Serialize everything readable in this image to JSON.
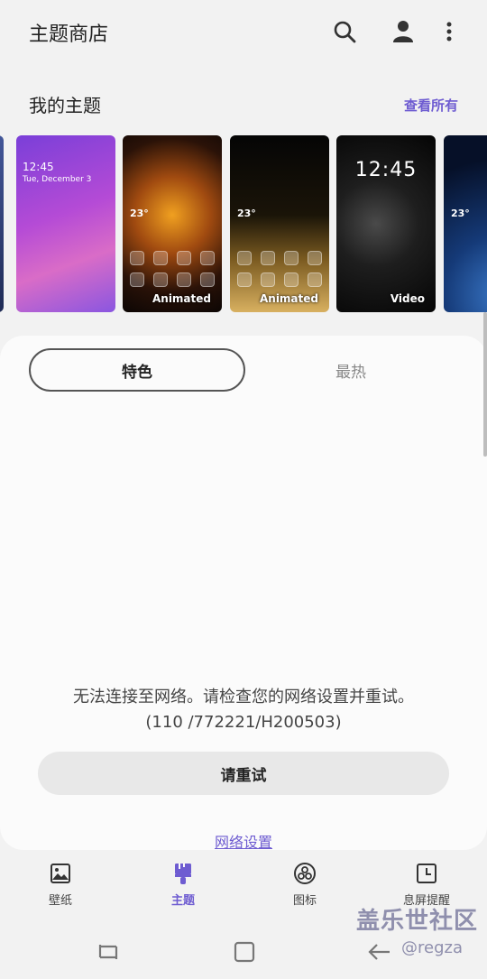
{
  "header": {
    "title": "主题商店",
    "icons": [
      "search-icon",
      "account-icon",
      "more-vert-icon"
    ]
  },
  "my_themes": {
    "title": "我的主题",
    "view_all": "查看所有",
    "thumbnails": [
      {
        "clock": "12:45",
        "date": "Tue, December 3",
        "badge": ""
      },
      {
        "weather": "23°",
        "badge": "Animated"
      },
      {
        "weather": "23°",
        "badge": "Animated"
      },
      {
        "clock": "12:45",
        "badge": "Video"
      },
      {
        "weather": "23°",
        "badge": ""
      }
    ]
  },
  "tabs": {
    "featured": "特色",
    "popular": "最热"
  },
  "error": {
    "message": "无法连接至网络。请检查您的网络设置并重试。",
    "code": "(110 /772221/H200503)",
    "retry_label": "请重试",
    "network_settings_link": "网络设置"
  },
  "bottom_nav": [
    {
      "label": "壁纸",
      "icon": "image-icon",
      "active": false
    },
    {
      "label": "主题",
      "icon": "brush-icon",
      "active": true
    },
    {
      "label": "图标",
      "icon": "icons-icon",
      "active": false
    },
    {
      "label": "息屏提醒",
      "icon": "clock-icon",
      "active": false
    }
  ],
  "watermark": {
    "text": "盖乐世社区",
    "handle": "@regza"
  },
  "colors": {
    "accent": "#6e5cd1",
    "background": "#f2f2f2"
  }
}
